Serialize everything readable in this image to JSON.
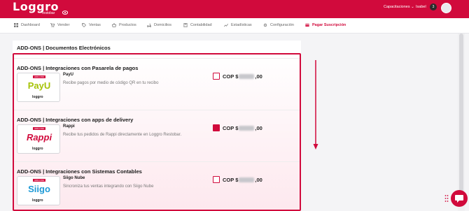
{
  "header": {
    "logo_text": "Loggro",
    "logo_sub": "restobar",
    "capacitaciones": "Capacitaciones ⌄",
    "user_name": "Isabel",
    "badge_count": "3",
    "accent_color": "#d10a3c"
  },
  "nav": {
    "items": [
      {
        "label": "Dashboard",
        "icon": "dashboard-icon"
      },
      {
        "label": "Vender",
        "icon": "cart-icon"
      },
      {
        "label": "Ventas",
        "icon": "tag-icon"
      },
      {
        "label": "Productos",
        "icon": "basket-icon"
      },
      {
        "label": "Domicilios",
        "icon": "scooter-icon"
      },
      {
        "label": "Contabilidad",
        "icon": "calculator-icon"
      },
      {
        "label": "Estadísticas",
        "icon": "chart-icon"
      },
      {
        "label": "Configuración",
        "icon": "gear-icon"
      },
      {
        "label": "Pagar Suscripción",
        "icon": "card-icon"
      }
    ]
  },
  "main": {
    "docs_title": "ADD-ONS | Documentos Electrónicos",
    "sections": [
      {
        "title": "ADD-ONS | Integraciones con Pasarela de pagos",
        "item_name": "PayU",
        "item_desc": "Recibe pagos por medio de código QR en tu recibo",
        "brand": "PayU",
        "checked": false,
        "price_prefix": "COP $",
        "price_suffix": ",00"
      },
      {
        "title": "ADD-ONS | Integraciones con apps de delivery",
        "item_name": "Rappi",
        "item_desc": "Recibe tus pedidos de Rappi directamente en Loggro Restobar.",
        "brand": "Rappi",
        "checked": true,
        "price_prefix": "COP $",
        "price_suffix": ",00"
      },
      {
        "title": "ADD-ONS | Integraciones con Sistemas Contables",
        "item_name": "Siigo Nube",
        "item_desc": "Sincroniza tus ventas integrando con Siigo Nube",
        "brand": "Siigo",
        "checked": false,
        "price_prefix": "COP $",
        "price_suffix": ",00"
      }
    ],
    "mini_logo": "loggro"
  }
}
